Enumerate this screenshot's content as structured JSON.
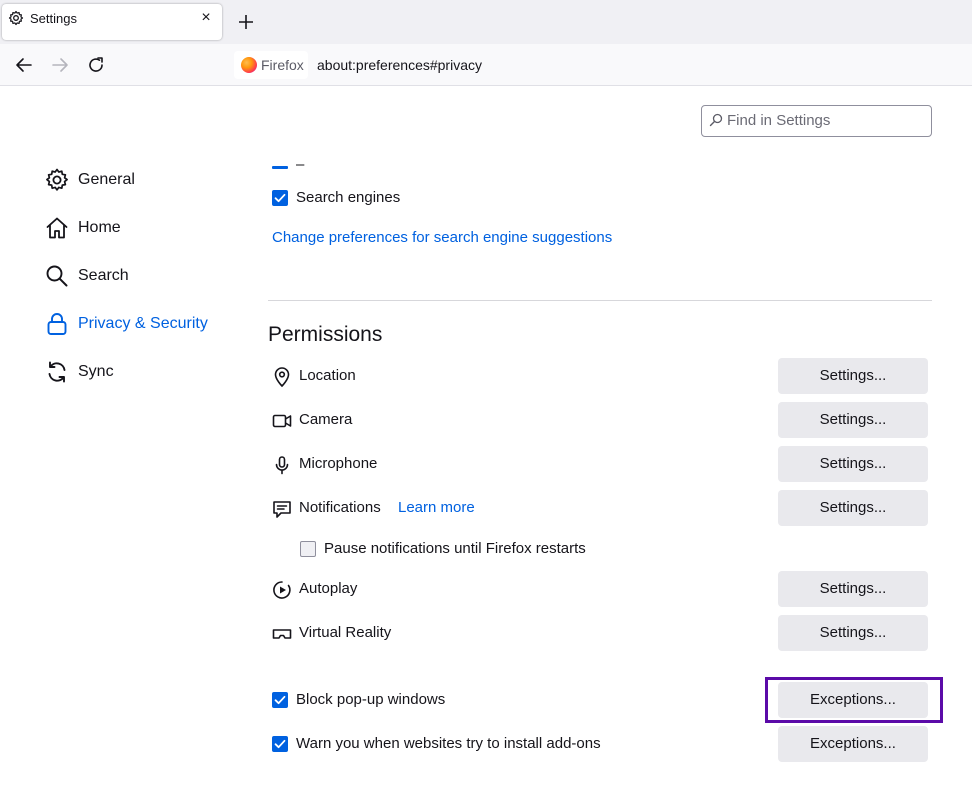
{
  "browser": {
    "tab_title": "Settings",
    "tab_close": "×",
    "identity_label": "Firefox",
    "url": "about:preferences#privacy"
  },
  "search": {
    "placeholder": "Find in Settings"
  },
  "sidebar": {
    "items": [
      {
        "label": "General",
        "icon": "gear-icon"
      },
      {
        "label": "Home",
        "icon": "home-icon"
      },
      {
        "label": "Search",
        "icon": "search-icon"
      },
      {
        "label": "Privacy & Security",
        "icon": "lock-icon",
        "selected": true
      },
      {
        "label": "Sync",
        "icon": "sync-icon"
      }
    ]
  },
  "search_suggestions": {
    "partial_label": "–",
    "search_engines_label": "Search engines",
    "search_engines_checked": true,
    "change_prefs_link": "Change preferences for search engine suggestions"
  },
  "permissions": {
    "heading": "Permissions",
    "items": [
      {
        "label": "Location",
        "icon": "location-icon",
        "button": "Settings..."
      },
      {
        "label": "Camera",
        "icon": "camera-icon",
        "button": "Settings..."
      },
      {
        "label": "Microphone",
        "icon": "microphone-icon",
        "button": "Settings..."
      },
      {
        "label": "Notifications",
        "icon": "notifications-icon",
        "button": "Settings...",
        "link": "Learn more"
      },
      {
        "label": "Autoplay",
        "icon": "autoplay-icon",
        "button": "Settings..."
      },
      {
        "label": "Virtual Reality",
        "icon": "vr-icon",
        "button": "Settings..."
      }
    ],
    "pause_notifications_label": "Pause notifications until Firefox restarts",
    "pause_notifications_checked": false,
    "block_popups_label": "Block pop-up windows",
    "block_popups_checked": true,
    "block_popups_button": "Exceptions...",
    "warn_addons_label": "Warn you when websites try to install add-ons",
    "warn_addons_checked": true,
    "warn_addons_button": "Exceptions..."
  },
  "colors": {
    "accent": "#0061e0",
    "highlight": "#5b0aa8",
    "button_bg": "#e9e9ed"
  }
}
